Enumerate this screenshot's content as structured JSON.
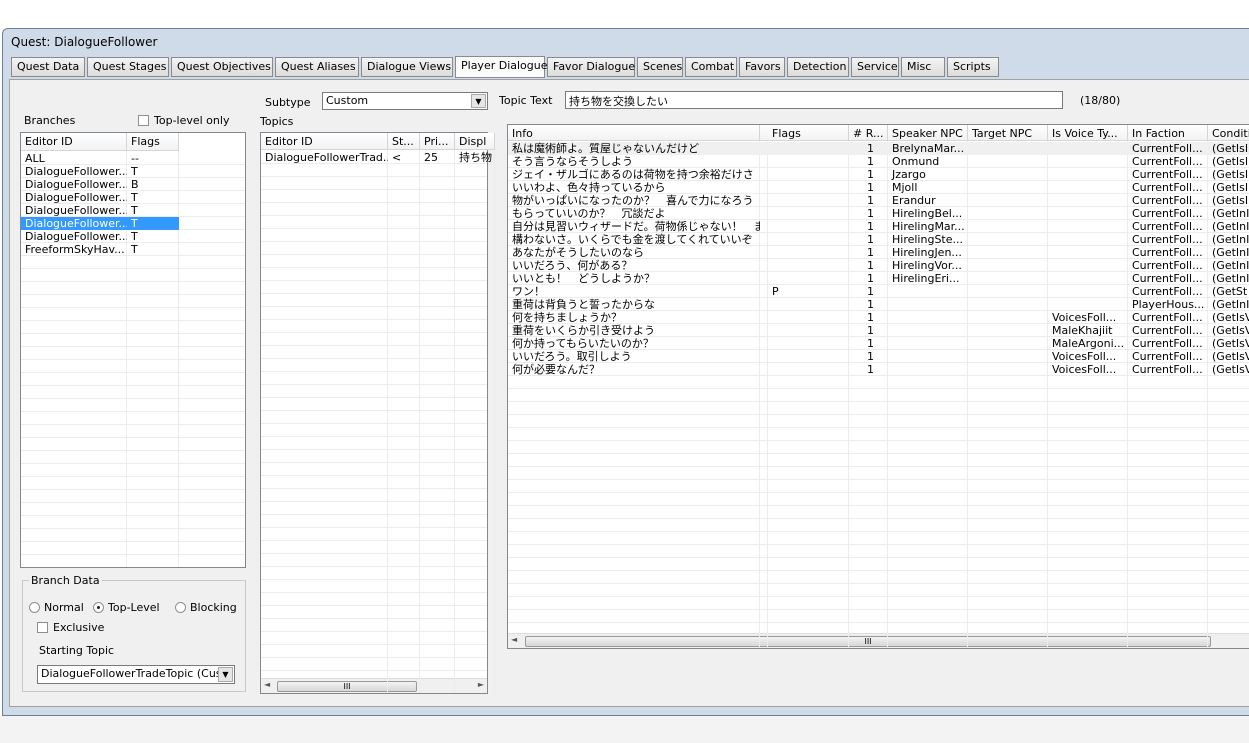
{
  "window": {
    "title": "Quest: DialogueFollower"
  },
  "tabs": [
    "Quest Data",
    "Quest Stages",
    "Quest Objectives",
    "Quest Aliases",
    "Dialogue Views",
    "Player Dialogue",
    "Favor Dialogue",
    "Scenes",
    "Combat",
    "Favors",
    "Detection",
    "Service",
    "Misc",
    "Scripts"
  ],
  "active_tab": "Player Dialogue",
  "branches": {
    "label": "Branches",
    "top_level_only": "Top-level only",
    "top_level_checked": false,
    "columns": [
      "Editor ID",
      "Flags"
    ],
    "rows": [
      [
        "ALL",
        "--"
      ],
      [
        "DialogueFollower...",
        "T"
      ],
      [
        "DialogueFollower...",
        "B"
      ],
      [
        "DialogueFollower...",
        "T"
      ],
      [
        "DialogueFollower...",
        "T"
      ],
      [
        "DialogueFollower...",
        "T"
      ],
      [
        "DialogueFollower...",
        "T"
      ],
      [
        "FreeformSkyHav...",
        "T"
      ]
    ],
    "selected_index": 5
  },
  "branch_data": {
    "label": "Branch Data",
    "radio_normal": "Normal",
    "radio_top": "Top-Level",
    "radio_blocking": "Blocking",
    "selected": "Top-Level",
    "exclusive": "Exclusive",
    "starting_topic_label": "Starting Topic",
    "starting_topic": "DialogueFollowerTradeTopic (Cust"
  },
  "subtype": {
    "label": "Subtype",
    "value": "Custom"
  },
  "topics": {
    "label": "Topics",
    "columns": [
      "Editor ID",
      "St...",
      "Pri...",
      "Displ"
    ],
    "rows": [
      [
        "DialogueFollowerTrad...",
        "<",
        "25",
        "持ち物"
      ]
    ]
  },
  "topic_text": {
    "label": "Topic Text",
    "value": "持ち物を交換したい",
    "count": "(18/80)"
  },
  "info": {
    "columns": [
      "Info",
      "",
      "Flags",
      "# R...",
      "Speaker NPC",
      "Target NPC",
      "Is Voice Ty...",
      "In Faction",
      "Conditio"
    ],
    "rows": [
      [
        "私は魔術師よ。質屋じゃないんだけど",
        "",
        "",
        "1",
        "BrelynaMar...",
        "",
        "",
        "CurrentFoll...",
        "(GetIsI"
      ],
      [
        "そう言うならそうしよう",
        "",
        "",
        "1",
        "Onmund",
        "",
        "",
        "CurrentFoll...",
        "(GetIsI"
      ],
      [
        "ジェイ・ザルゴにあるのは荷物を持つ余裕だけさ",
        "",
        "",
        "1",
        "Jzargo",
        "",
        "",
        "CurrentFoll...",
        "(GetIsI"
      ],
      [
        "いいわよ、色々持っているから",
        "",
        "",
        "1",
        "Mjoll",
        "",
        "",
        "CurrentFoll...",
        "(GetIsI"
      ],
      [
        "物がいっぱいになったのか？　喜んで力になろう",
        "",
        "",
        "1",
        "Erandur",
        "",
        "",
        "CurrentFoll...",
        "(GetIsI"
      ],
      [
        "もらっていいのか？　冗談だよ",
        "",
        "",
        "1",
        "HirelingBel...",
        "",
        "",
        "CurrentFoll...",
        "(GetInI"
      ],
      [
        "自分は見習いウィザードだ。荷物係じゃない！　ま...",
        "",
        "",
        "1",
        "HirelingMar...",
        "",
        "",
        "CurrentFoll...",
        "(GetInI"
      ],
      [
        "構わないさ。いくらでも金を渡してくれていいぞ",
        "",
        "",
        "1",
        "HirelingSte...",
        "",
        "",
        "CurrentFoll...",
        "(GetInI"
      ],
      [
        "あなたがそうしたいのなら",
        "",
        "",
        "1",
        "HirelingJen...",
        "",
        "",
        "CurrentFoll...",
        "(GetInI"
      ],
      [
        "いいだろう、何がある？",
        "",
        "",
        "1",
        "HirelingVor...",
        "",
        "",
        "CurrentFoll...",
        "(GetInI"
      ],
      [
        "いいとも！　どうしようか？",
        "",
        "",
        "1",
        "HirelingEri...",
        "",
        "",
        "CurrentFoll...",
        "(GetInI"
      ],
      [
        "ワン！",
        "",
        "P",
        "1",
        "",
        "",
        "",
        "CurrentFoll...",
        "(GetSt"
      ],
      [
        "重荷は背負うと誓ったからな",
        "",
        "",
        "1",
        "",
        "",
        "",
        "PlayerHous...",
        "(GetInI"
      ],
      [
        "何を持ちましょうか？",
        "",
        "",
        "1",
        "",
        "",
        "VoicesFoll...",
        "CurrentFoll...",
        "(GetIsV"
      ],
      [
        "重荷をいくらか引き受けよう",
        "",
        "",
        "1",
        "",
        "",
        "MaleKhajiit",
        "CurrentFoll...",
        "(GetIsV"
      ],
      [
        "何か持ってもらいたいのか？",
        "",
        "",
        "1",
        "",
        "",
        "MaleArgoni...",
        "CurrentFoll...",
        "(GetIsV"
      ],
      [
        "いいだろう。取引しよう",
        "",
        "",
        "1",
        "",
        "",
        "VoicesFoll...",
        "CurrentFoll...",
        "(GetIsV"
      ],
      [
        "何が必要なんだ？",
        "",
        "",
        "1",
        "",
        "",
        "VoicesFoll...",
        "CurrentFoll...",
        "(GetIsV"
      ]
    ]
  },
  "scroll_grip": "III",
  "colors": {
    "selection": "#3399ff",
    "window_frame": "#cfdbe8",
    "panel": "#f0f0f0"
  }
}
